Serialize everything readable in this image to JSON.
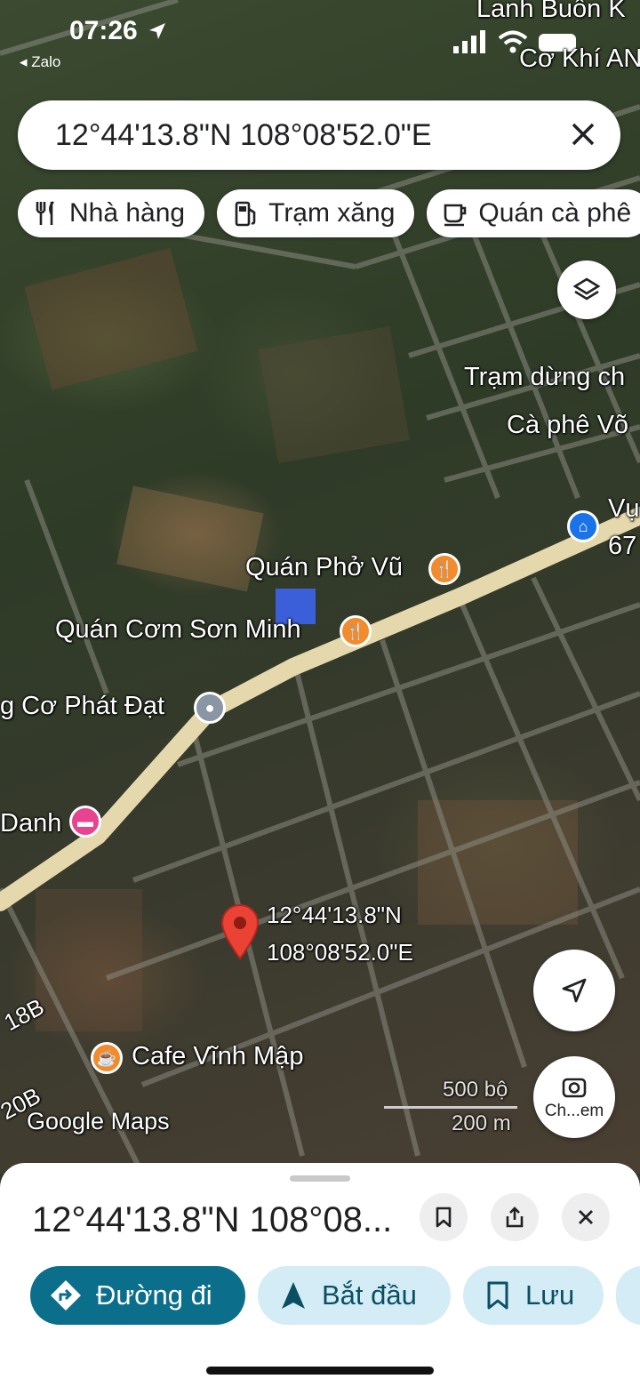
{
  "status": {
    "time": "07:26",
    "back_app": "◂ Zalo"
  },
  "search": {
    "query": "12°44'13.8\"N 108°08'52.0\"E"
  },
  "chips": [
    {
      "icon": "restaurant-icon",
      "label": "Nhà hàng"
    },
    {
      "icon": "gas-station-icon",
      "label": "Trạm xăng"
    },
    {
      "icon": "coffee-icon",
      "label": "Quán cà phê"
    }
  ],
  "map": {
    "labels": {
      "top1": "Lanh Buôn K",
      "top2": "Cơ Khí AN",
      "tram": "Trạm dừng ch",
      "caphe": "Cà phê Võ",
      "vu": "Vụ",
      "vu_num": "67",
      "pho": "Quán Phở Vũ",
      "com": "Quán Cơm Sơn Minh",
      "co": "g Cơ Phát Đạt",
      "danh": "Danh",
      "cafe": "Cafe Vĩnh Mập",
      "road1": "18B",
      "road2": "20B"
    },
    "pin_coords_line1": "12°44'13.8\"N",
    "pin_coords_line2": "108°08'52.0\"E",
    "logo": "Google Maps",
    "scale_ft": "500 bộ",
    "scale_m": "200 m",
    "camera_label": "Ch...em"
  },
  "sheet": {
    "title": "12°44'13.8\"N 108°08...",
    "directions": "Đường đi",
    "start": "Bắt đầu",
    "save": "Lưu"
  },
  "colors": {
    "accent": "#0b6e8a",
    "chip_blue": "#d4ecf5",
    "pin_red": "#ea4335",
    "food_orange": "#f28b2b"
  }
}
